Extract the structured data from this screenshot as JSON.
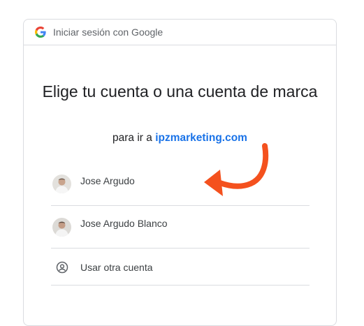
{
  "header": {
    "title": "Iniciar sesión con Google",
    "logo_icon": "google-g-icon"
  },
  "main": {
    "headline": "Elige tu cuenta o una cuenta de marca",
    "subline_prefix": "para ir a ",
    "subline_domain": "ipzmarketing.com"
  },
  "accounts": [
    {
      "name": "Jose Argudo",
      "avatar": "user-photo-avatar"
    },
    {
      "name": "Jose Argudo Blanco",
      "avatar": "user-photo-avatar"
    }
  ],
  "other_account": {
    "label": "Usar otra cuenta",
    "icon": "account-circle-icon"
  },
  "annotation": {
    "arrow_icon": "curved-arrow-icon",
    "color": "#f4511e"
  },
  "colors": {
    "accent_blue": "#1a73e8",
    "divider": "#dadce0"
  }
}
